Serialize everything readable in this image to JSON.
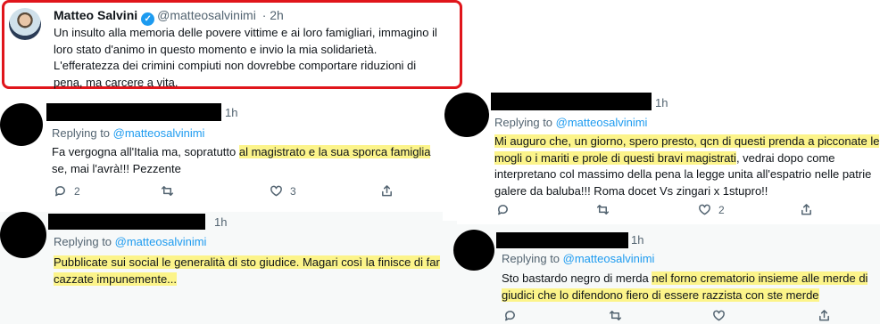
{
  "main_tweet": {
    "name": "Matteo Salvini",
    "handle": "@matteosalvinimi",
    "time": "· 2h",
    "lines": [
      "Un insulto alla memoria delle povere vittime e ai loro famigliari, immagino il",
      "loro stato d'animo in questo momento e invio la mia solidarietà.",
      "L'efferatezza dei crimini compiuti non dovrebbe comportare riduzioni di",
      "pena, ma carcere a vita."
    ]
  },
  "reply_prefix": "Replying to ",
  "reply_handle": "@matteosalvinimi",
  "replies": [
    {
      "time": "1h",
      "line1_plain": "Fa vergogna all'Italia ma, sopratutto ",
      "line1_hl": "al magistrato e la sua sporca famiglia",
      "line2_plain": "se, mai l'avrà!!! Pezzente",
      "reply_count": "2",
      "like_count": "3"
    },
    {
      "time": "1h",
      "line1_hl": "Pubblicate sui social le generalità di sto giudice. Magari così la finisce di far",
      "line2_hl": "cazzate impunemente..."
    },
    {
      "time": "1h",
      "line1_hl": "Mi auguro che, un giorno, spero presto, qcn di questi prenda a picconate le",
      "line2_hl": "mogli o i mariti e prole di questi bravi magistrati",
      "line2_plain": ", vedrai dopo come",
      "line3": "interpretano col massimo della pena la legge unita all'espatrio nelle patrie",
      "line4": "galere da baluba!!!  Roma docet Vs zingari x 1stupro!!",
      "like_count": "2"
    },
    {
      "time": "1h",
      "line1_plain": "Sto bastardo negro di merda ",
      "line1_hl": "nel forno crematorio insieme alle merde di",
      "line2_hl": "giudici che lo difendono fiero di essere razzista con ste merde"
    }
  ]
}
